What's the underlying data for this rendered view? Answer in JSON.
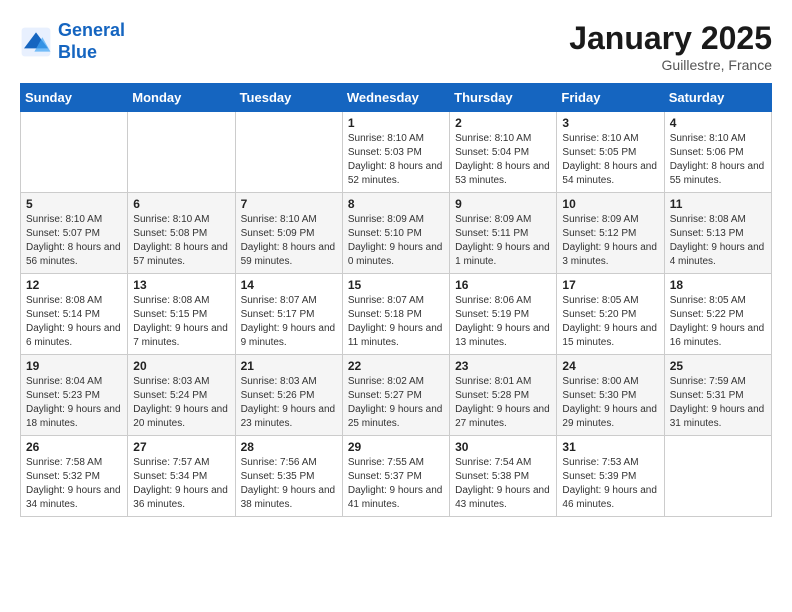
{
  "header": {
    "logo_line1": "General",
    "logo_line2": "Blue",
    "title": "January 2025",
    "subtitle": "Guillestre, France"
  },
  "weekdays": [
    "Sunday",
    "Monday",
    "Tuesday",
    "Wednesday",
    "Thursday",
    "Friday",
    "Saturday"
  ],
  "weeks": [
    [
      {
        "day": "",
        "info": ""
      },
      {
        "day": "",
        "info": ""
      },
      {
        "day": "",
        "info": ""
      },
      {
        "day": "1",
        "info": "Sunrise: 8:10 AM\nSunset: 5:03 PM\nDaylight: 8 hours and 52 minutes."
      },
      {
        "day": "2",
        "info": "Sunrise: 8:10 AM\nSunset: 5:04 PM\nDaylight: 8 hours and 53 minutes."
      },
      {
        "day": "3",
        "info": "Sunrise: 8:10 AM\nSunset: 5:05 PM\nDaylight: 8 hours and 54 minutes."
      },
      {
        "day": "4",
        "info": "Sunrise: 8:10 AM\nSunset: 5:06 PM\nDaylight: 8 hours and 55 minutes."
      }
    ],
    [
      {
        "day": "5",
        "info": "Sunrise: 8:10 AM\nSunset: 5:07 PM\nDaylight: 8 hours and 56 minutes."
      },
      {
        "day": "6",
        "info": "Sunrise: 8:10 AM\nSunset: 5:08 PM\nDaylight: 8 hours and 57 minutes."
      },
      {
        "day": "7",
        "info": "Sunrise: 8:10 AM\nSunset: 5:09 PM\nDaylight: 8 hours and 59 minutes."
      },
      {
        "day": "8",
        "info": "Sunrise: 8:09 AM\nSunset: 5:10 PM\nDaylight: 9 hours and 0 minutes."
      },
      {
        "day": "9",
        "info": "Sunrise: 8:09 AM\nSunset: 5:11 PM\nDaylight: 9 hours and 1 minute."
      },
      {
        "day": "10",
        "info": "Sunrise: 8:09 AM\nSunset: 5:12 PM\nDaylight: 9 hours and 3 minutes."
      },
      {
        "day": "11",
        "info": "Sunrise: 8:08 AM\nSunset: 5:13 PM\nDaylight: 9 hours and 4 minutes."
      }
    ],
    [
      {
        "day": "12",
        "info": "Sunrise: 8:08 AM\nSunset: 5:14 PM\nDaylight: 9 hours and 6 minutes."
      },
      {
        "day": "13",
        "info": "Sunrise: 8:08 AM\nSunset: 5:15 PM\nDaylight: 9 hours and 7 minutes."
      },
      {
        "day": "14",
        "info": "Sunrise: 8:07 AM\nSunset: 5:17 PM\nDaylight: 9 hours and 9 minutes."
      },
      {
        "day": "15",
        "info": "Sunrise: 8:07 AM\nSunset: 5:18 PM\nDaylight: 9 hours and 11 minutes."
      },
      {
        "day": "16",
        "info": "Sunrise: 8:06 AM\nSunset: 5:19 PM\nDaylight: 9 hours and 13 minutes."
      },
      {
        "day": "17",
        "info": "Sunrise: 8:05 AM\nSunset: 5:20 PM\nDaylight: 9 hours and 15 minutes."
      },
      {
        "day": "18",
        "info": "Sunrise: 8:05 AM\nSunset: 5:22 PM\nDaylight: 9 hours and 16 minutes."
      }
    ],
    [
      {
        "day": "19",
        "info": "Sunrise: 8:04 AM\nSunset: 5:23 PM\nDaylight: 9 hours and 18 minutes."
      },
      {
        "day": "20",
        "info": "Sunrise: 8:03 AM\nSunset: 5:24 PM\nDaylight: 9 hours and 20 minutes."
      },
      {
        "day": "21",
        "info": "Sunrise: 8:03 AM\nSunset: 5:26 PM\nDaylight: 9 hours and 23 minutes."
      },
      {
        "day": "22",
        "info": "Sunrise: 8:02 AM\nSunset: 5:27 PM\nDaylight: 9 hours and 25 minutes."
      },
      {
        "day": "23",
        "info": "Sunrise: 8:01 AM\nSunset: 5:28 PM\nDaylight: 9 hours and 27 minutes."
      },
      {
        "day": "24",
        "info": "Sunrise: 8:00 AM\nSunset: 5:30 PM\nDaylight: 9 hours and 29 minutes."
      },
      {
        "day": "25",
        "info": "Sunrise: 7:59 AM\nSunset: 5:31 PM\nDaylight: 9 hours and 31 minutes."
      }
    ],
    [
      {
        "day": "26",
        "info": "Sunrise: 7:58 AM\nSunset: 5:32 PM\nDaylight: 9 hours and 34 minutes."
      },
      {
        "day": "27",
        "info": "Sunrise: 7:57 AM\nSunset: 5:34 PM\nDaylight: 9 hours and 36 minutes."
      },
      {
        "day": "28",
        "info": "Sunrise: 7:56 AM\nSunset: 5:35 PM\nDaylight: 9 hours and 38 minutes."
      },
      {
        "day": "29",
        "info": "Sunrise: 7:55 AM\nSunset: 5:37 PM\nDaylight: 9 hours and 41 minutes."
      },
      {
        "day": "30",
        "info": "Sunrise: 7:54 AM\nSunset: 5:38 PM\nDaylight: 9 hours and 43 minutes."
      },
      {
        "day": "31",
        "info": "Sunrise: 7:53 AM\nSunset: 5:39 PM\nDaylight: 9 hours and 46 minutes."
      },
      {
        "day": "",
        "info": ""
      }
    ]
  ]
}
